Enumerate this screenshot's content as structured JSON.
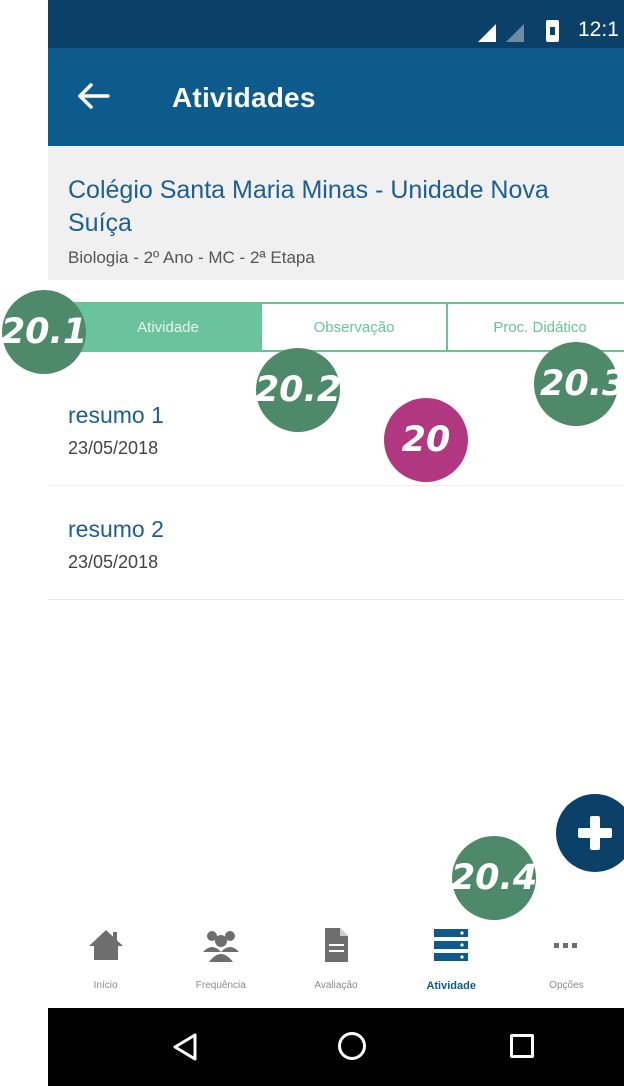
{
  "status_bar": {
    "time": "12:1"
  },
  "app_bar": {
    "title": "Atividades",
    "back_icon": "arrow-left-icon"
  },
  "header": {
    "school": "Colégio Santa Maria Minas - Unidade Nova Suíça",
    "course": "Biologia - 2º Ano - MC - 2ª Etapa"
  },
  "tabs": [
    {
      "label": "Atividade",
      "active": true
    },
    {
      "label": "Observação",
      "active": false
    },
    {
      "label": "Proc. Didático",
      "active": false
    }
  ],
  "list": [
    {
      "title": "resumo 1",
      "date": "23/05/2018"
    },
    {
      "title": "resumo 2",
      "date": "23/05/2018"
    }
  ],
  "fab": {
    "icon": "plus-icon"
  },
  "bottom_nav": [
    {
      "label": "Início",
      "icon": "home-icon",
      "active": false
    },
    {
      "label": "Frequência",
      "icon": "people-icon",
      "active": false
    },
    {
      "label": "Avaliação",
      "icon": "document-icon",
      "active": false
    },
    {
      "label": "Atividade",
      "icon": "list-icon",
      "active": true
    },
    {
      "label": "Opções",
      "icon": "more-icon",
      "active": false
    }
  ],
  "annotations": [
    {
      "label": "20.1",
      "color": "#4e8a6a"
    },
    {
      "label": "20.2",
      "color": "#4e8a6a"
    },
    {
      "label": "20.3",
      "color": "#4e8a6a"
    },
    {
      "label": "20",
      "color": "#b03780"
    },
    {
      "label": "20.4",
      "color": "#4e8a6a"
    }
  ],
  "colors": {
    "status_bar": "#0b4068",
    "app_bar": "#0d5a8c",
    "accent_green": "#6bc39b",
    "link_blue": "#1c5f92"
  }
}
